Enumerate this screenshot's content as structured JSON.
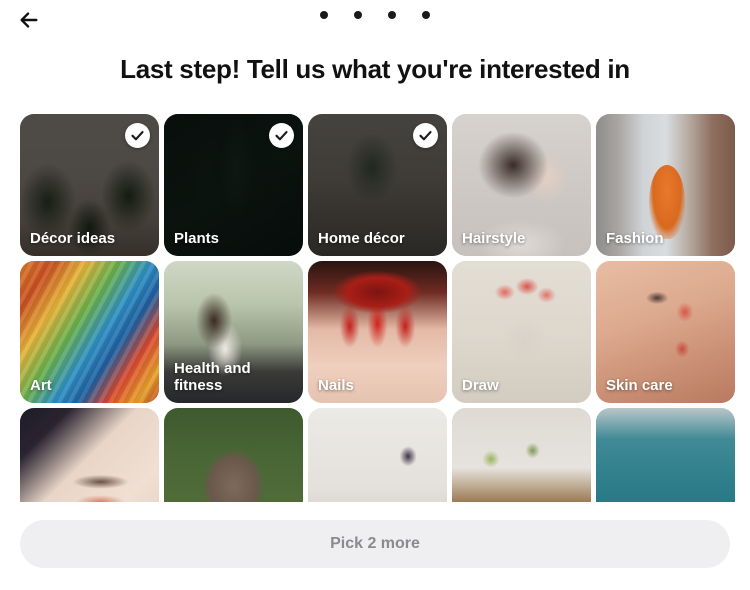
{
  "header": {
    "back_icon": "back-arrow-icon",
    "progress_dots": [
      {
        "state": "filled"
      },
      {
        "state": "filled"
      },
      {
        "state": "filled"
      },
      {
        "state": "filled"
      }
    ]
  },
  "title": "Last step! Tell us what you're interested in",
  "grid": {
    "tiles": [
      {
        "label": "Décor ideas",
        "selected": true,
        "art": "a-decor",
        "check_icon": "check-icon"
      },
      {
        "label": "Plants",
        "selected": true,
        "art": "a-plants",
        "check_icon": "check-icon"
      },
      {
        "label": "Home décor",
        "selected": true,
        "art": "a-homedecor",
        "check_icon": "check-icon"
      },
      {
        "label": "Hairstyle",
        "selected": false,
        "art": "a-hairstyle",
        "check_icon": ""
      },
      {
        "label": "Fashion",
        "selected": false,
        "art": "a-fashion",
        "check_icon": ""
      },
      {
        "label": "Art",
        "selected": false,
        "art": "a-art",
        "check_icon": ""
      },
      {
        "label": "Health and fitness",
        "selected": false,
        "art": "a-health",
        "check_icon": ""
      },
      {
        "label": "Nails",
        "selected": false,
        "art": "a-nails",
        "check_icon": ""
      },
      {
        "label": "Draw",
        "selected": false,
        "art": "a-draw",
        "check_icon": ""
      },
      {
        "label": "Skin care",
        "selected": false,
        "art": "a-skincare",
        "check_icon": ""
      },
      {
        "label": "",
        "selected": false,
        "art": "a-eyes",
        "check_icon": ""
      },
      {
        "label": "",
        "selected": false,
        "art": "a-elephant",
        "check_icon": ""
      },
      {
        "label": "",
        "selected": false,
        "art": "a-food",
        "check_icon": ""
      },
      {
        "label": "",
        "selected": false,
        "art": "a-shelf",
        "check_icon": ""
      },
      {
        "label": "",
        "selected": false,
        "art": "a-sea",
        "check_icon": ""
      }
    ]
  },
  "cta": {
    "label": "Pick 2 more",
    "enabled": false
  },
  "colors": {
    "page_bg": "#ffffff",
    "title_text": "#111111",
    "cta_bg": "#efeef0",
    "cta_text": "#8a8a8f",
    "dot": "#1a1a1a",
    "tile_label": "#ffffff"
  }
}
